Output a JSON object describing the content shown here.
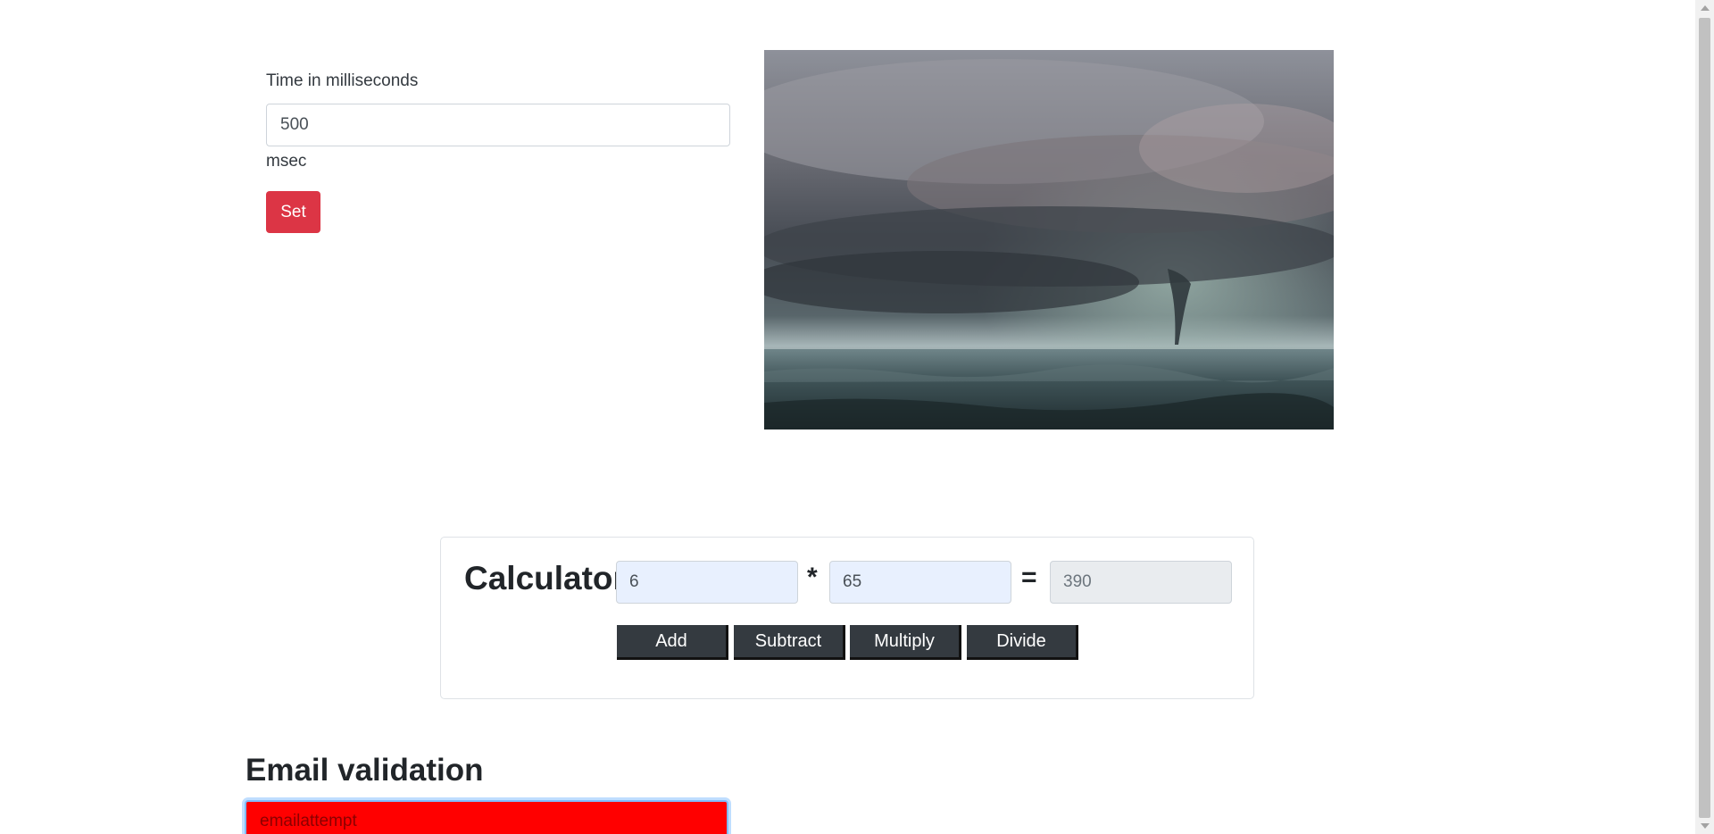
{
  "timer": {
    "label": "Time in milliseconds",
    "value": "500",
    "unit": "msec",
    "set_label": "Set"
  },
  "image": {
    "subject": "tornado-over-ocean"
  },
  "calculator": {
    "title": "Calculator",
    "operand_a": "6",
    "operator": "*",
    "operand_b": "65",
    "equals": "=",
    "result": "390",
    "buttons": {
      "add": "Add",
      "subtract": "Subtract",
      "multiply": "Multiply",
      "divide": "Divide"
    }
  },
  "email": {
    "heading": "Email validation",
    "value": "emailattempt"
  },
  "colors": {
    "danger": "#dc3545",
    "invalid_bg": "#ff0000",
    "button_dark": "#343a40",
    "autofill_bg": "#e8f0fe"
  }
}
